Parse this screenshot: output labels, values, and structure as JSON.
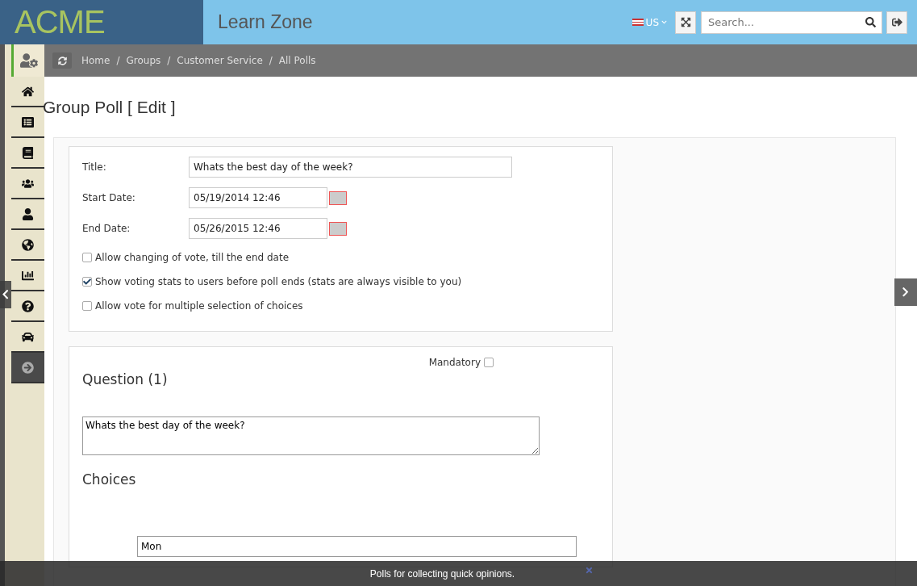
{
  "header": {
    "logo": "ACME",
    "app_title": "Learn Zone",
    "locale": "US",
    "search": {
      "placeholder": "Search..."
    }
  },
  "breadcrumbs": [
    "Home",
    "Groups",
    "Customer Service",
    "All Polls"
  ],
  "breadcrumb_separators": [
    "/",
    "/",
    "/"
  ],
  "sidebar": {
    "items": [
      {
        "selected": false
      },
      {
        "selected": false
      },
      {
        "selected": false
      },
      {
        "selected": false
      },
      {
        "selected": false
      },
      {
        "selected": false
      },
      {
        "selected": false
      },
      {
        "selected": false
      },
      {
        "selected": false
      },
      {
        "selected": true
      }
    ]
  },
  "page_title": "Group Poll [ Edit ]",
  "settings": {
    "fields": [
      {
        "label": "Title:",
        "value": "Whats the best day of the week?",
        "kind": "text"
      },
      {
        "label": "Start Date:",
        "value": "05/19/2014 12:46",
        "kind": "date"
      },
      {
        "label": "End Date:",
        "value": "05/26/2015 12:46",
        "kind": "date"
      }
    ],
    "options": [
      {
        "label": "Allow changing of vote, till the end date",
        "checked": false
      },
      {
        "label": "Show voting stats to users before poll ends (stats are always visible to you)",
        "checked": true
      },
      {
        "label": "Allow vote for multiple selection of choices",
        "checked": false
      }
    ]
  },
  "question": {
    "mandatory_label": "Mandatory",
    "mandatory": false,
    "heading": "Question (1)",
    "text": "Whats the best day of the week?",
    "choices_heading": "Choices",
    "choices": [
      "Mon"
    ]
  },
  "notice": {
    "text": "Polls for collecting quick opinions."
  }
}
